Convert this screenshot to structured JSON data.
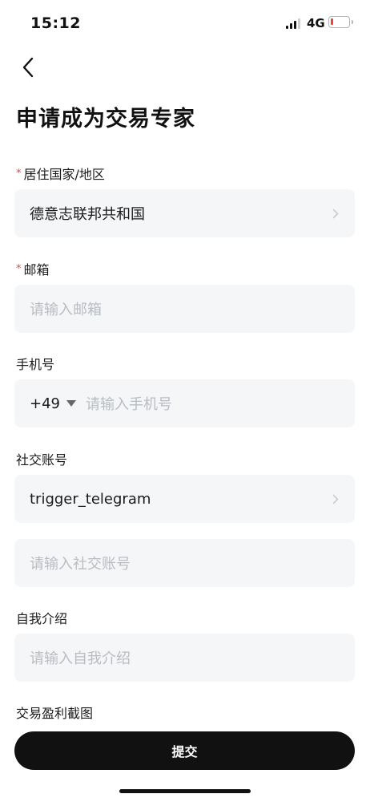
{
  "status_bar": {
    "time": "15:12",
    "network": "4G",
    "battery_level": 0.15,
    "battery_color": "#f04438"
  },
  "header": {
    "back_icon": "chevron-left-icon",
    "title": "申请成为交易专家"
  },
  "form": {
    "country": {
      "required_mark": "*",
      "label": "居住国家/地区",
      "value": "德意志联邦共和国"
    },
    "email": {
      "required_mark": "*",
      "label": "邮箱",
      "placeholder": "请输入邮箱"
    },
    "phone": {
      "label": "手机号",
      "country_code": "+49",
      "placeholder": "请输入手机号"
    },
    "social": {
      "label": "社交账号",
      "platform_value": "trigger_telegram",
      "placeholder": "请输入社交账号"
    },
    "intro": {
      "label": "自我介绍",
      "placeholder": "请输入自我介绍"
    },
    "screenshot": {
      "label": "交易盈利截图"
    }
  },
  "submit": {
    "label": "提交"
  },
  "colors": {
    "accent": "#111111",
    "required": "#e5484d",
    "field_bg": "#f5f6f8",
    "placeholder": "#b8bcc3"
  }
}
